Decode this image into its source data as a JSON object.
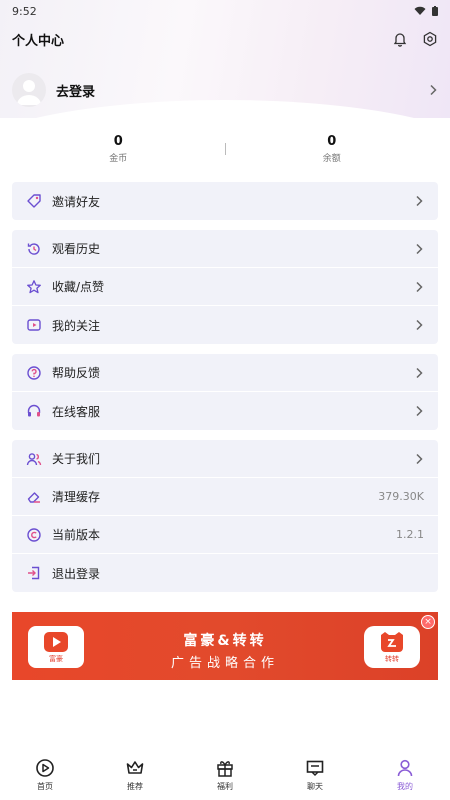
{
  "status_bar": {
    "time": "9:52"
  },
  "header": {
    "title": "个人中心"
  },
  "profile": {
    "login_label": "去登录"
  },
  "stats": [
    {
      "value": "0",
      "label": "金币"
    },
    {
      "value": "0",
      "label": "余额"
    }
  ],
  "menu": {
    "invite": {
      "label": "邀请好友"
    },
    "history": {
      "label": "观看历史"
    },
    "favorites": {
      "label": "收藏/点赞"
    },
    "following": {
      "label": "我的关注"
    },
    "feedback": {
      "label": "帮助反馈"
    },
    "support": {
      "label": "在线客服"
    },
    "about": {
      "label": "关于我们"
    },
    "cache": {
      "label": "清理缓存",
      "value": "379.30K"
    },
    "version": {
      "label": "当前版本",
      "value": "1.2.1"
    },
    "logout": {
      "label": "退出登录"
    }
  },
  "banner": {
    "title": "富豪&转转",
    "subtitle": "广告战略合作",
    "left_logo_text": "富豪",
    "right_logo_text": "转转"
  },
  "tabs": [
    {
      "label": "首页",
      "icon": "play-circle-icon"
    },
    {
      "label": "推荐",
      "icon": "crown-icon"
    },
    {
      "label": "福利",
      "icon": "gift-icon"
    },
    {
      "label": "聊天",
      "icon": "chat-icon"
    },
    {
      "label": "我的",
      "icon": "user-icon",
      "active": true
    }
  ],
  "colors": {
    "accent": "#8a5cd6",
    "card_bg": "#f1f2f9",
    "banner_red": "#e24a2c"
  }
}
